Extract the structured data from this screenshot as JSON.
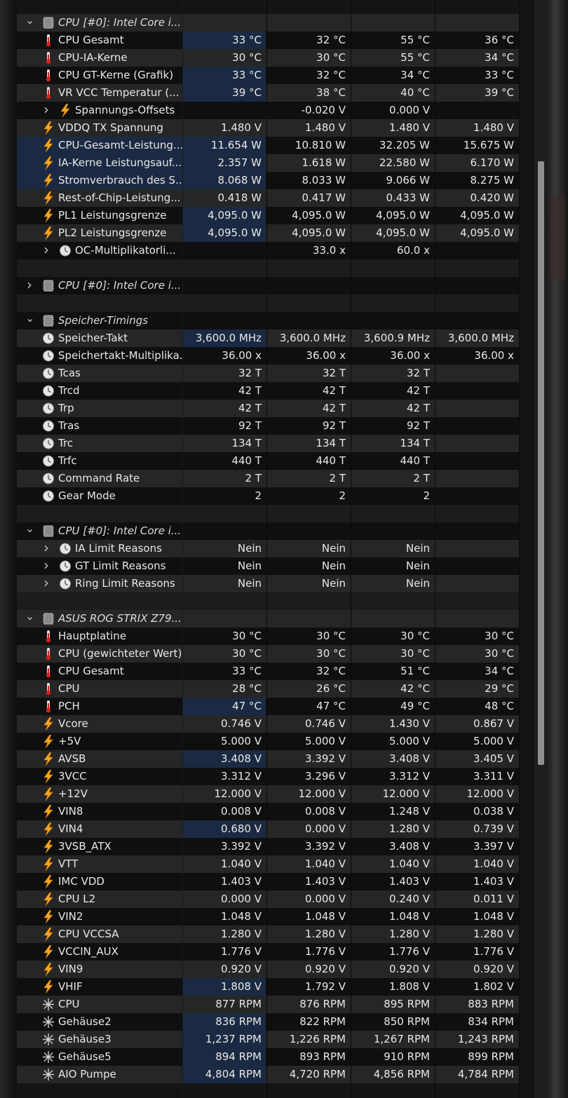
{
  "window": {
    "accent_highlight": "#1b2a42"
  },
  "scrollbar": {
    "thumb_start_fraction": 0.147,
    "thumb_end_fraction": 0.697
  },
  "rows": [
    {
      "type": "group",
      "expanded": true,
      "label": "CPU [#0]: Intel Core i...",
      "icon": "chip-icon"
    },
    {
      "type": "sensor",
      "icon": "thermometer-icon",
      "label": "CPU Gesamt",
      "values": [
        "33 °C",
        "32 °C",
        "55 °C",
        "36 °C"
      ],
      "hl": true
    },
    {
      "type": "sensor",
      "icon": "thermometer-icon",
      "label": "CPU-IA-Kerne",
      "values": [
        "30 °C",
        "30 °C",
        "55 °C",
        "34 °C"
      ]
    },
    {
      "type": "sensor",
      "icon": "thermometer-icon",
      "label": "CPU GT-Kerne (Grafik)",
      "values": [
        "33 °C",
        "32 °C",
        "34 °C",
        "33 °C"
      ],
      "hl": true
    },
    {
      "type": "sensor",
      "icon": "thermometer-icon",
      "label": "VR VCC Temperatur (...",
      "values": [
        "39 °C",
        "38 °C",
        "40 °C",
        "39 °C"
      ],
      "hl": true
    },
    {
      "type": "sensor",
      "sub": true,
      "icon": "lightning-icon",
      "label": "Spannungs-Offsets",
      "values": [
        "",
        "-0.020 V",
        "0.000 V",
        ""
      ]
    },
    {
      "type": "sensor",
      "icon": "lightning-icon",
      "label": "VDDQ TX Spannung",
      "values": [
        "1.480 V",
        "1.480 V",
        "1.480 V",
        "1.480 V"
      ]
    },
    {
      "type": "sensor",
      "icon": "lightning-icon",
      "label": "CPU-Gesamt-Leistung...",
      "values": [
        "11.654 W",
        "10.810 W",
        "32.205 W",
        "15.675 W"
      ],
      "hl": true,
      "hl_label": true
    },
    {
      "type": "sensor",
      "icon": "lightning-icon",
      "label": "IA-Kerne Leistungsauf...",
      "values": [
        "2.357 W",
        "1.618 W",
        "22.580 W",
        "6.170 W"
      ],
      "hl": true,
      "hl_label": true
    },
    {
      "type": "sensor",
      "icon": "lightning-icon",
      "label": "Stromverbrauch des S...",
      "values": [
        "8.068 W",
        "8.033 W",
        "9.066 W",
        "8.275 W"
      ],
      "hl": true,
      "hl_label": true
    },
    {
      "type": "sensor",
      "icon": "lightning-icon",
      "label": "Rest-of-Chip-Leistung...",
      "values": [
        "0.418 W",
        "0.417 W",
        "0.433 W",
        "0.420 W"
      ]
    },
    {
      "type": "sensor",
      "icon": "lightning-icon",
      "label": "PL1 Leistungsgrenze",
      "values": [
        "4,095.0 W",
        "4,095.0 W",
        "4,095.0 W",
        "4,095.0 W"
      ],
      "hl": true
    },
    {
      "type": "sensor",
      "icon": "lightning-icon",
      "label": "PL2 Leistungsgrenze",
      "values": [
        "4,095.0 W",
        "4,095.0 W",
        "4,095.0 W",
        "4,095.0 W"
      ],
      "hl": true
    },
    {
      "type": "sensor",
      "sub": true,
      "icon": "clock-icon",
      "label": "OC-Multiplikatorli...",
      "values": [
        "",
        "33.0 x",
        "60.0 x",
        ""
      ]
    },
    {
      "type": "blank"
    },
    {
      "type": "group",
      "expanded": false,
      "label": "CPU [#0]: Intel Core i...",
      "icon": "chip-icon"
    },
    {
      "type": "blank"
    },
    {
      "type": "group",
      "expanded": true,
      "label": "Speicher-Timings",
      "icon": "chip-icon"
    },
    {
      "type": "sensor",
      "icon": "clock-icon",
      "label": "Speicher-Takt",
      "values": [
        "3,600.0 MHz",
        "3,600.0 MHz",
        "3,600.9 MHz",
        "3,600.0 MHz"
      ],
      "hl": true
    },
    {
      "type": "sensor",
      "icon": "clock-icon",
      "label": "Speichertakt-Multiplika...",
      "values": [
        "36.00 x",
        "36.00 x",
        "36.00 x",
        "36.00 x"
      ]
    },
    {
      "type": "sensor",
      "icon": "clock-icon",
      "label": "Tcas",
      "values": [
        "32 T",
        "32 T",
        "32 T",
        ""
      ]
    },
    {
      "type": "sensor",
      "icon": "clock-icon",
      "label": "Trcd",
      "values": [
        "42 T",
        "42 T",
        "42 T",
        ""
      ]
    },
    {
      "type": "sensor",
      "icon": "clock-icon",
      "label": "Trp",
      "values": [
        "42 T",
        "42 T",
        "42 T",
        ""
      ]
    },
    {
      "type": "sensor",
      "icon": "clock-icon",
      "label": "Tras",
      "values": [
        "92 T",
        "92 T",
        "92 T",
        ""
      ]
    },
    {
      "type": "sensor",
      "icon": "clock-icon",
      "label": "Trc",
      "values": [
        "134 T",
        "134 T",
        "134 T",
        ""
      ]
    },
    {
      "type": "sensor",
      "icon": "clock-icon",
      "label": "Trfc",
      "values": [
        "440 T",
        "440 T",
        "440 T",
        ""
      ]
    },
    {
      "type": "sensor",
      "icon": "clock-icon",
      "label": "Command Rate",
      "values": [
        "2 T",
        "2 T",
        "2 T",
        ""
      ]
    },
    {
      "type": "sensor",
      "icon": "clock-icon",
      "label": "Gear Mode",
      "values": [
        "2",
        "2",
        "2",
        ""
      ]
    },
    {
      "type": "blank"
    },
    {
      "type": "group",
      "expanded": true,
      "label": "CPU [#0]: Intel Core i...",
      "icon": "chip-icon"
    },
    {
      "type": "sensor",
      "sub": true,
      "icon": "clock-icon",
      "label": "IA Limit Reasons",
      "values": [
        "Nein",
        "Nein",
        "Nein",
        ""
      ]
    },
    {
      "type": "sensor",
      "sub": true,
      "icon": "clock-icon",
      "label": "GT Limit Reasons",
      "values": [
        "Nein",
        "Nein",
        "Nein",
        ""
      ]
    },
    {
      "type": "sensor",
      "sub": true,
      "icon": "clock-icon",
      "label": "Ring Limit Reasons",
      "values": [
        "Nein",
        "Nein",
        "Nein",
        ""
      ]
    },
    {
      "type": "blank"
    },
    {
      "type": "group",
      "expanded": true,
      "label": "ASUS ROG STRIX Z79...",
      "icon": "chip-icon"
    },
    {
      "type": "sensor",
      "icon": "thermometer-icon",
      "label": "Hauptplatine",
      "values": [
        "30 °C",
        "30 °C",
        "30 °C",
        "30 °C"
      ]
    },
    {
      "type": "sensor",
      "icon": "thermometer-icon",
      "label": "CPU (gewichteter Wert)",
      "values": [
        "30 °C",
        "30 °C",
        "30 °C",
        "30 °C"
      ]
    },
    {
      "type": "sensor",
      "icon": "thermometer-icon",
      "label": "CPU Gesamt",
      "values": [
        "33 °C",
        "32 °C",
        "51 °C",
        "34 °C"
      ]
    },
    {
      "type": "sensor",
      "icon": "thermometer-icon",
      "label": "CPU",
      "values": [
        "28 °C",
        "26 °C",
        "42 °C",
        "29 °C"
      ]
    },
    {
      "type": "sensor",
      "icon": "thermometer-icon",
      "label": "PCH",
      "values": [
        "47 °C",
        "47 °C",
        "49 °C",
        "48 °C"
      ],
      "hl": true
    },
    {
      "type": "sensor",
      "icon": "lightning-icon",
      "label": "Vcore",
      "values": [
        "0.746 V",
        "0.746 V",
        "1.430 V",
        "0.867 V"
      ]
    },
    {
      "type": "sensor",
      "icon": "lightning-icon",
      "label": "+5V",
      "values": [
        "5.000 V",
        "5.000 V",
        "5.000 V",
        "5.000 V"
      ]
    },
    {
      "type": "sensor",
      "icon": "lightning-icon",
      "label": "AVSB",
      "values": [
        "3.408 V",
        "3.392 V",
        "3.408 V",
        "3.405 V"
      ],
      "hl": true
    },
    {
      "type": "sensor",
      "icon": "lightning-icon",
      "label": "3VCC",
      "values": [
        "3.312 V",
        "3.296 V",
        "3.312 V",
        "3.311 V"
      ]
    },
    {
      "type": "sensor",
      "icon": "lightning-icon",
      "label": "+12V",
      "values": [
        "12.000 V",
        "12.000 V",
        "12.000 V",
        "12.000 V"
      ]
    },
    {
      "type": "sensor",
      "icon": "lightning-icon",
      "label": "VIN8",
      "values": [
        "0.008 V",
        "0.008 V",
        "1.248 V",
        "0.038 V"
      ]
    },
    {
      "type": "sensor",
      "icon": "lightning-icon",
      "label": "VIN4",
      "values": [
        "0.680 V",
        "0.000 V",
        "1.280 V",
        "0.739 V"
      ],
      "hl": true
    },
    {
      "type": "sensor",
      "icon": "lightning-icon",
      "label": "3VSB_ATX",
      "values": [
        "3.392 V",
        "3.392 V",
        "3.408 V",
        "3.397 V"
      ]
    },
    {
      "type": "sensor",
      "icon": "lightning-icon",
      "label": "VTT",
      "values": [
        "1.040 V",
        "1.040 V",
        "1.040 V",
        "1.040 V"
      ]
    },
    {
      "type": "sensor",
      "icon": "lightning-icon",
      "label": "IMC VDD",
      "values": [
        "1.403 V",
        "1.403 V",
        "1.403 V",
        "1.403 V"
      ]
    },
    {
      "type": "sensor",
      "icon": "lightning-icon",
      "label": "CPU L2",
      "values": [
        "0.000 V",
        "0.000 V",
        "0.240 V",
        "0.011 V"
      ]
    },
    {
      "type": "sensor",
      "icon": "lightning-icon",
      "label": "VIN2",
      "values": [
        "1.048 V",
        "1.048 V",
        "1.048 V",
        "1.048 V"
      ]
    },
    {
      "type": "sensor",
      "icon": "lightning-icon",
      "label": "CPU VCCSA",
      "values": [
        "1.280 V",
        "1.280 V",
        "1.280 V",
        "1.280 V"
      ]
    },
    {
      "type": "sensor",
      "icon": "lightning-icon",
      "label": "VCCIN_AUX",
      "values": [
        "1.776 V",
        "1.776 V",
        "1.776 V",
        "1.776 V"
      ]
    },
    {
      "type": "sensor",
      "icon": "lightning-icon",
      "label": "VIN9",
      "values": [
        "0.920 V",
        "0.920 V",
        "0.920 V",
        "0.920 V"
      ]
    },
    {
      "type": "sensor",
      "icon": "lightning-icon",
      "label": "VHIF",
      "values": [
        "1.808 V",
        "1.792 V",
        "1.808 V",
        "1.802 V"
      ],
      "hl": true
    },
    {
      "type": "sensor",
      "icon": "fan-icon",
      "label": "CPU",
      "values": [
        "877 RPM",
        "876 RPM",
        "895 RPM",
        "883 RPM"
      ]
    },
    {
      "type": "sensor",
      "icon": "fan-icon",
      "label": "Gehäuse2",
      "values": [
        "836 RPM",
        "822 RPM",
        "850 RPM",
        "834 RPM"
      ],
      "hl": true
    },
    {
      "type": "sensor",
      "icon": "fan-icon",
      "label": "Gehäuse3",
      "values": [
        "1,237 RPM",
        "1,226 RPM",
        "1,267 RPM",
        "1,243 RPM"
      ],
      "hl": true
    },
    {
      "type": "sensor",
      "icon": "fan-icon",
      "label": "Gehäuse5",
      "values": [
        "894 RPM",
        "893 RPM",
        "910 RPM",
        "899 RPM"
      ],
      "hl": true
    },
    {
      "type": "sensor",
      "icon": "fan-icon",
      "label": "AIO Pumpe",
      "values": [
        "4,804 RPM",
        "4,720 RPM",
        "4,856 RPM",
        "4,784 RPM"
      ],
      "hl": true
    }
  ]
}
